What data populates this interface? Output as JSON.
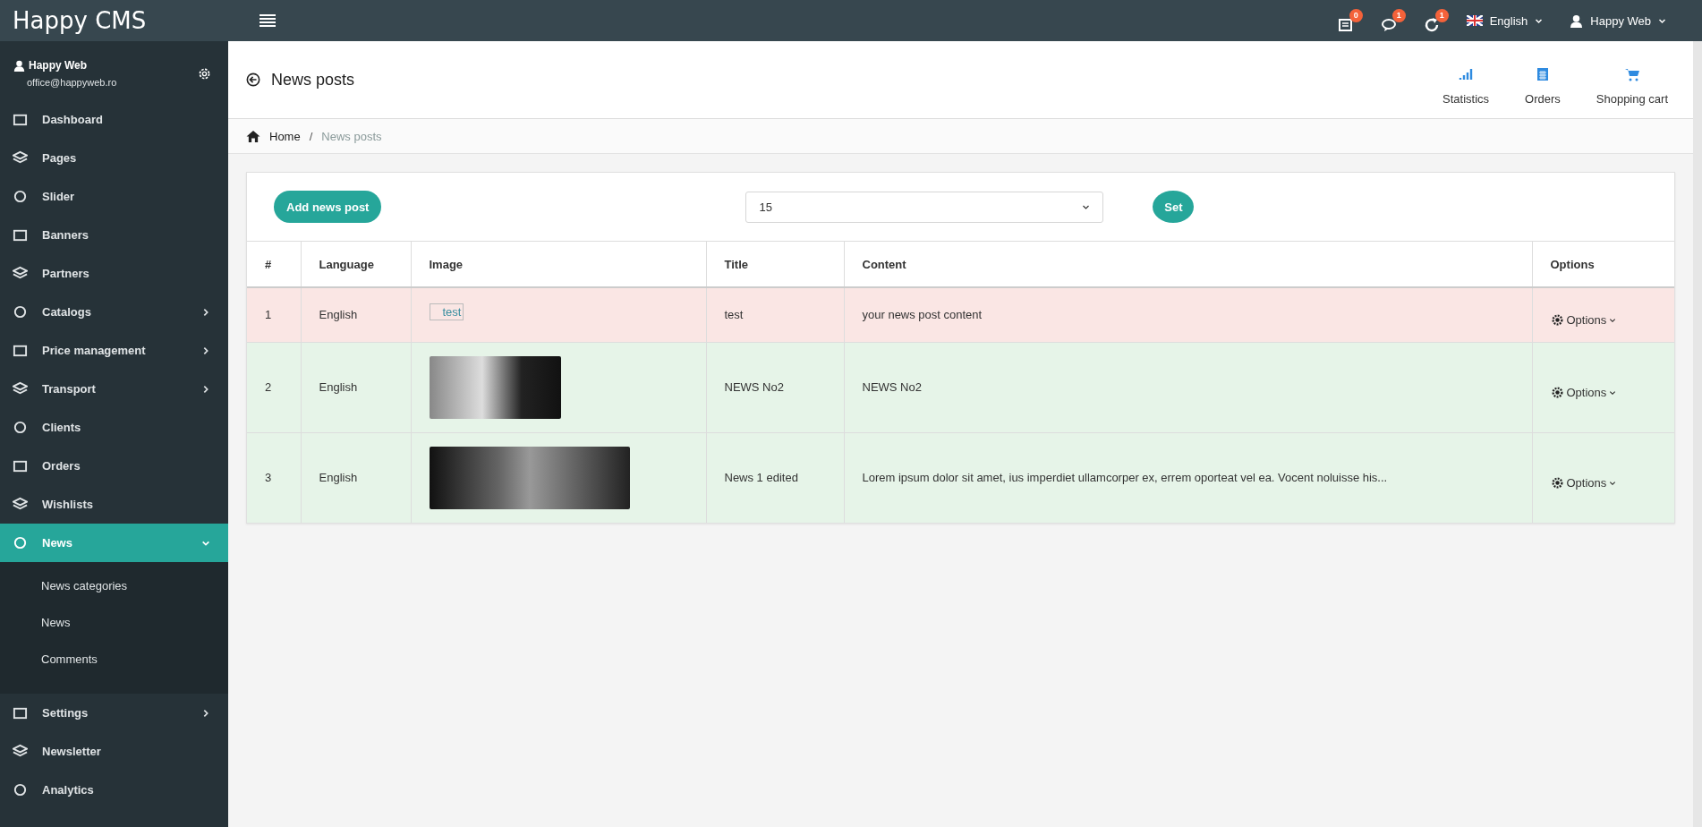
{
  "topbar": {
    "logo": "Happy CMS",
    "notifications": [
      {
        "count": "0"
      },
      {
        "count": "1"
      },
      {
        "count": "1"
      }
    ],
    "language": "English",
    "user": "Happy Web"
  },
  "sidebar": {
    "user": {
      "name": "Happy Web",
      "email": "office@happyweb.ro"
    },
    "items": [
      {
        "label": "Dashboard",
        "selected": false
      },
      {
        "label": "Pages",
        "selected": false
      },
      {
        "label": "Slider",
        "selected": false
      },
      {
        "label": "Banners",
        "selected": false
      },
      {
        "label": "Partners",
        "selected": false
      },
      {
        "label": "Catalogs",
        "expanded": false,
        "selected": false
      },
      {
        "label": "Price management",
        "expanded": false,
        "selected": false
      },
      {
        "label": "Transport",
        "expanded": false,
        "selected": false
      },
      {
        "label": "Clients",
        "selected": false
      },
      {
        "label": "Orders",
        "selected": false
      },
      {
        "label": "Wishlists",
        "selected": false
      },
      {
        "label": "News",
        "expanded": true,
        "selected": true,
        "children": [
          {
            "label": "News categories"
          },
          {
            "label": "News"
          },
          {
            "label": "Comments"
          }
        ]
      },
      {
        "label": "Settings",
        "expanded": false,
        "selected": false
      },
      {
        "label": "Newsletter",
        "selected": false
      },
      {
        "label": "Analytics",
        "selected": false
      }
    ]
  },
  "page_header": {
    "title": "News posts",
    "shortcuts": [
      {
        "label": "Statistics"
      },
      {
        "label": "Orders"
      },
      {
        "label": "Shopping cart"
      }
    ]
  },
  "breadcrumb": {
    "separator": "/",
    "items": [
      {
        "label": "Home"
      },
      {
        "label": "News posts"
      }
    ]
  },
  "toolbar": {
    "add_button": "Add news post",
    "per_page": "15",
    "set_button": "Set"
  },
  "table": {
    "columns": [
      "#",
      "Language",
      "Image",
      "Title",
      "Content",
      "Options"
    ],
    "rows": [
      {
        "number": "1",
        "language": "English",
        "image": {
          "kind": "broken",
          "alt": "test"
        },
        "title": "test",
        "content": "your news post content",
        "options": "Options",
        "color": "#fae6e4"
      },
      {
        "number": "2",
        "language": "English",
        "image": {
          "kind": "photo"
        },
        "title": "NEWS No2",
        "content": "NEWS No2",
        "options": "Options",
        "color": "#e6f4e8"
      },
      {
        "number": "3",
        "language": "English",
        "image": {
          "kind": "wide-photo"
        },
        "title": "News 1 edited",
        "content": "Lorem ipsum dolor sit amet, ius imperdiet ullamcorper ex, errem oporteat vel ea. Vocent noluisse his...",
        "options": "Options",
        "color": "#e6f4e8"
      }
    ]
  }
}
